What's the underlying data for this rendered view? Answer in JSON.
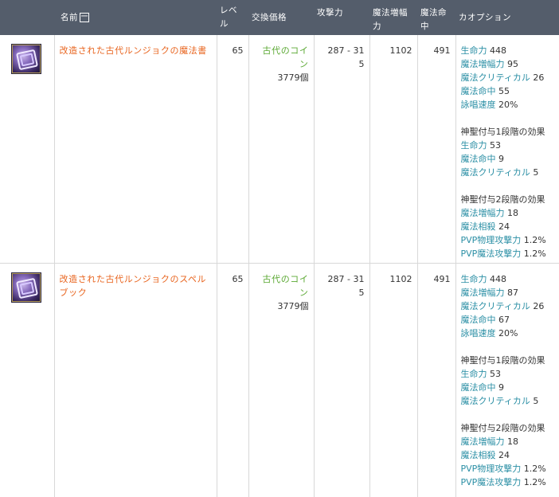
{
  "header": {
    "name": "名前",
    "toggle": "ー",
    "level": "レベル",
    "price": "交換価格",
    "attack": "攻撃力",
    "magic_amp": "魔法増幅力",
    "magic_acc": "魔法命中",
    "options": "カオプション"
  },
  "items": [
    {
      "name": "改造された古代ルンジョクの魔法書",
      "level": "65",
      "coin_label": "古代のコイン",
      "coin_count": "3779個",
      "attack_line1": "287 - 31",
      "attack_line2": "5",
      "magic_amp": "1102",
      "magic_acc": "491",
      "base_options": [
        {
          "key": "生命力",
          "val": "448"
        },
        {
          "key": "魔法増幅力",
          "val": "95"
        },
        {
          "key": "魔法クリティカル",
          "val": "26"
        },
        {
          "key": "魔法命中",
          "val": "55"
        },
        {
          "key": "詠唱速度",
          "val": "20%"
        }
      ],
      "enchant1_title": "神聖付与1段階の効果",
      "enchant1": [
        {
          "key": "生命力",
          "val": "53"
        },
        {
          "key": "魔法命中",
          "val": "9"
        },
        {
          "key": "魔法クリティカル",
          "val": "5"
        }
      ],
      "enchant2_title": "神聖付与2段階の効果",
      "enchant2": [
        {
          "key": "魔法増幅力",
          "val": "18"
        },
        {
          "key": "魔法相殺",
          "val": "24"
        },
        {
          "key": "PVP物理攻撃力",
          "val": "1.2%"
        },
        {
          "key": "PVP魔法攻撃力",
          "val": "1.2%"
        }
      ]
    },
    {
      "name": "改造された古代ルンジョクのスペルブック",
      "level": "65",
      "coin_label": "古代のコイン",
      "coin_count": "3779個",
      "attack_line1": "287 - 31",
      "attack_line2": "5",
      "magic_amp": "1102",
      "magic_acc": "491",
      "base_options": [
        {
          "key": "生命力",
          "val": "448"
        },
        {
          "key": "魔法増幅力",
          "val": "87"
        },
        {
          "key": "魔法クリティカル",
          "val": "26"
        },
        {
          "key": "魔法命中",
          "val": "67"
        },
        {
          "key": "詠唱速度",
          "val": "20%"
        }
      ],
      "enchant1_title": "神聖付与1段階の効果",
      "enchant1": [
        {
          "key": "生命力",
          "val": "53"
        },
        {
          "key": "魔法命中",
          "val": "9"
        },
        {
          "key": "魔法クリティカル",
          "val": "5"
        }
      ],
      "enchant2_title": "神聖付与2段階の効果",
      "enchant2": [
        {
          "key": "魔法増幅力",
          "val": "18"
        },
        {
          "key": "魔法相殺",
          "val": "24"
        },
        {
          "key": "PVP物理攻撃力",
          "val": "1.2%"
        },
        {
          "key": "PVP魔法攻撃力",
          "val": "1.2%"
        }
      ]
    }
  ]
}
